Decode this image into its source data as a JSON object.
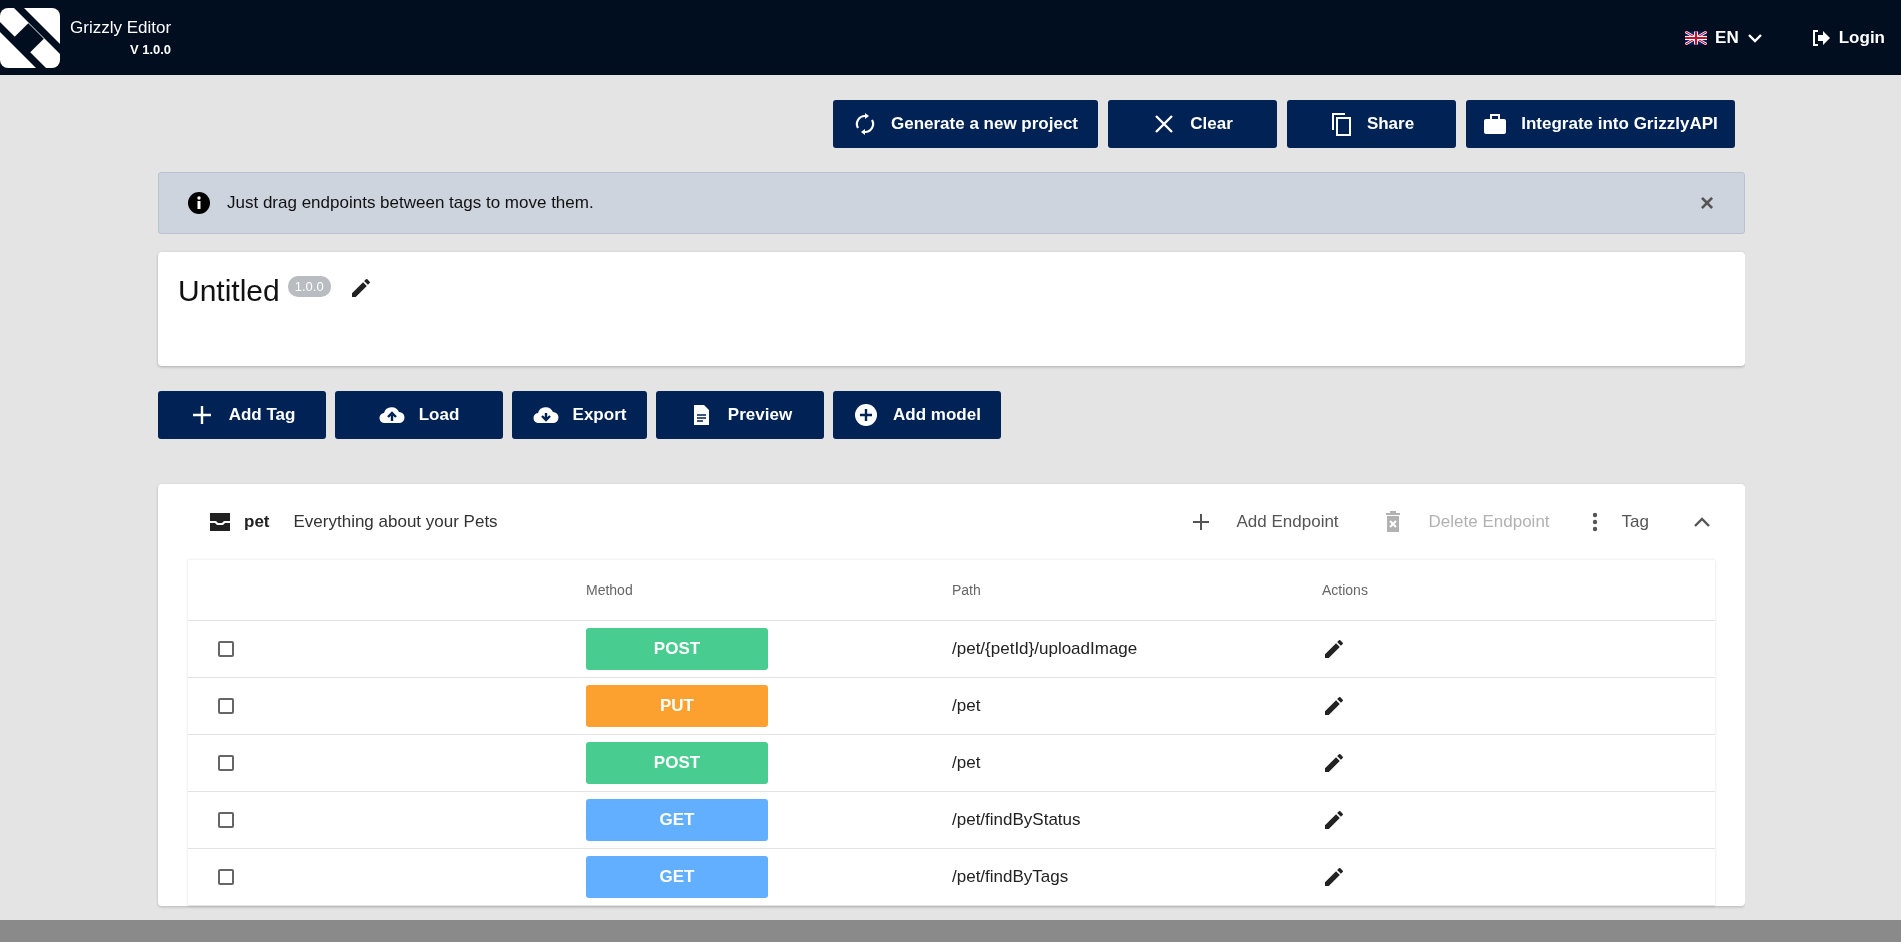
{
  "header": {
    "app_name": "Grizzly Editor",
    "version": "V 1.0.0",
    "language": "EN",
    "login": "Login"
  },
  "top_actions": [
    {
      "label": "Generate a new project"
    },
    {
      "label": "Clear"
    },
    {
      "label": "Share"
    },
    {
      "label": "Integrate into GrizzlyAPI"
    }
  ],
  "info_banner": {
    "text": "Just drag endpoints between tags to move them.",
    "close": "×"
  },
  "project": {
    "title": "Untitled",
    "version": "1.0.0"
  },
  "tools": [
    {
      "label": "Add Tag"
    },
    {
      "label": "Load"
    },
    {
      "label": "Export"
    },
    {
      "label": "Preview"
    },
    {
      "label": "Add model"
    }
  ],
  "tag": {
    "name": "pet",
    "description": "Everything about your Pets",
    "expanded": true,
    "actions": [
      {
        "label": "Add Endpoint",
        "disabled": false
      },
      {
        "label": "Delete Endpoint",
        "disabled": true
      },
      {
        "label": "Tag",
        "disabled": false
      }
    ],
    "table": {
      "columns": [
        "Method",
        "Path",
        "Actions"
      ],
      "rows": [
        {
          "checked": false,
          "method": "POST",
          "kind": "post",
          "path": "/pet/{petId}/uploadImage"
        },
        {
          "checked": false,
          "method": "PUT",
          "kind": "put",
          "path": "/pet"
        },
        {
          "checked": false,
          "method": "POST",
          "kind": "post",
          "path": "/pet"
        },
        {
          "checked": false,
          "method": "GET",
          "kind": "get",
          "path": "/pet/findByStatus"
        },
        {
          "checked": false,
          "method": "GET",
          "kind": "get",
          "path": "/pet/findByTags"
        }
      ]
    }
  }
}
